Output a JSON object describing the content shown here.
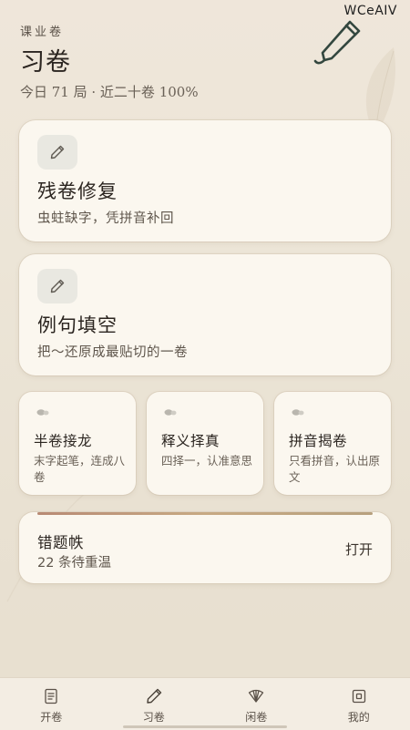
{
  "watermark": "WCeAIV",
  "header": {
    "label": "课业卷",
    "title": "习卷",
    "stats": "今日 71 局 · 近二十卷 100%"
  },
  "cards": [
    {
      "title": "残卷修复",
      "subtitle": "虫蛀缺字，凭拼音补回",
      "icon": "pencil-icon"
    },
    {
      "title": "例句填空",
      "subtitle": "把～还原成最贴切的一卷",
      "icon": "pencil-icon"
    }
  ],
  "modes": [
    {
      "title": "半卷接龙",
      "subtitle": "末字起笔，连成八卷"
    },
    {
      "title": "释义择真",
      "subtitle": "四择一，认准意思"
    },
    {
      "title": "拼音揭卷",
      "subtitle": "只看拼音，认出原文"
    }
  ],
  "mistakes": {
    "title": "错题帙",
    "subtitle": "22 条待重温",
    "action": "打开"
  },
  "nav": [
    {
      "label": "开卷",
      "icon": "scroll-icon"
    },
    {
      "label": "习卷",
      "icon": "pencil-icon",
      "active": true
    },
    {
      "label": "闲卷",
      "icon": "fan-icon"
    },
    {
      "label": "我的",
      "icon": "profile-icon"
    }
  ],
  "colors": {
    "background": "#ece5d7",
    "card": "#fbf7ef",
    "accent_line": "#c7a983",
    "text": "#2b2520"
  }
}
